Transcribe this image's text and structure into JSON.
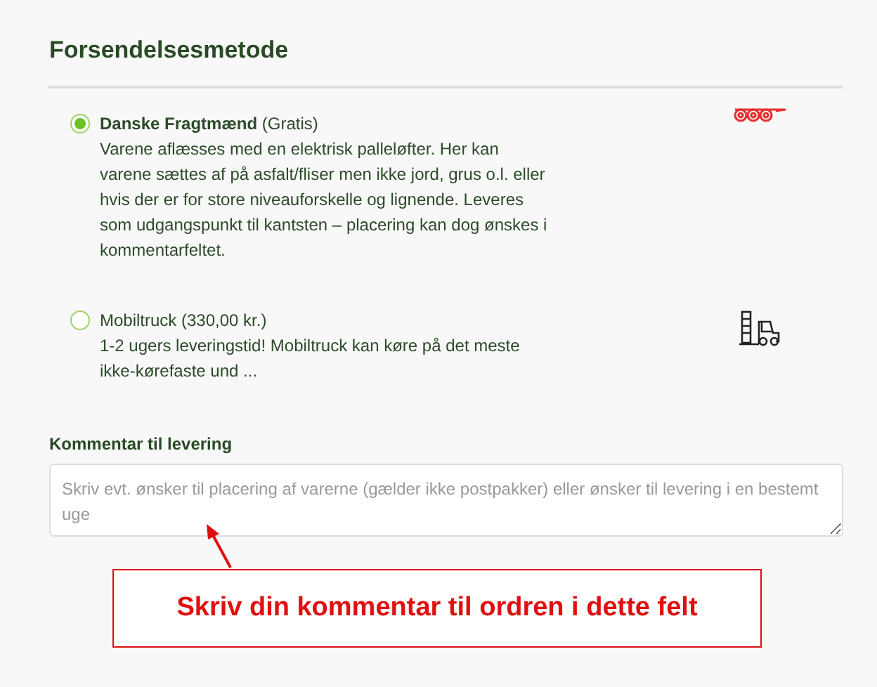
{
  "section": {
    "title": "Forsendelsesmetode"
  },
  "options": [
    {
      "label": "**Danske Fragtmænd** (Gratis)",
      "selected": true,
      "description": "Varene aflæsses med en elektrisk palleløfter. Her kan varene sættes af på asfalt/fliser men ikke jord, grus o.l. eller hvis der er for store niveauforskelle og lignende. Leveres som udgangspunkt til kantsten – placering kan dog ønskes i kommentarfeltet."
    },
    {
      "label": "Mobiltruck (330,00 kr.)",
      "selected": false,
      "description": "1-2 ugers leveringstid! Mobiltruck kan køre på det meste ikke-kørefaste und ..."
    }
  ],
  "comment": {
    "label": "Kommentar til levering",
    "placeholder": "Skriv evt. ønsker til placering af varerne (gælder ikke postpakker) eller ønsker til levering i en bestemt uge"
  },
  "callout": {
    "text": "Skriv din kommentar til ordren i dette felt"
  }
}
